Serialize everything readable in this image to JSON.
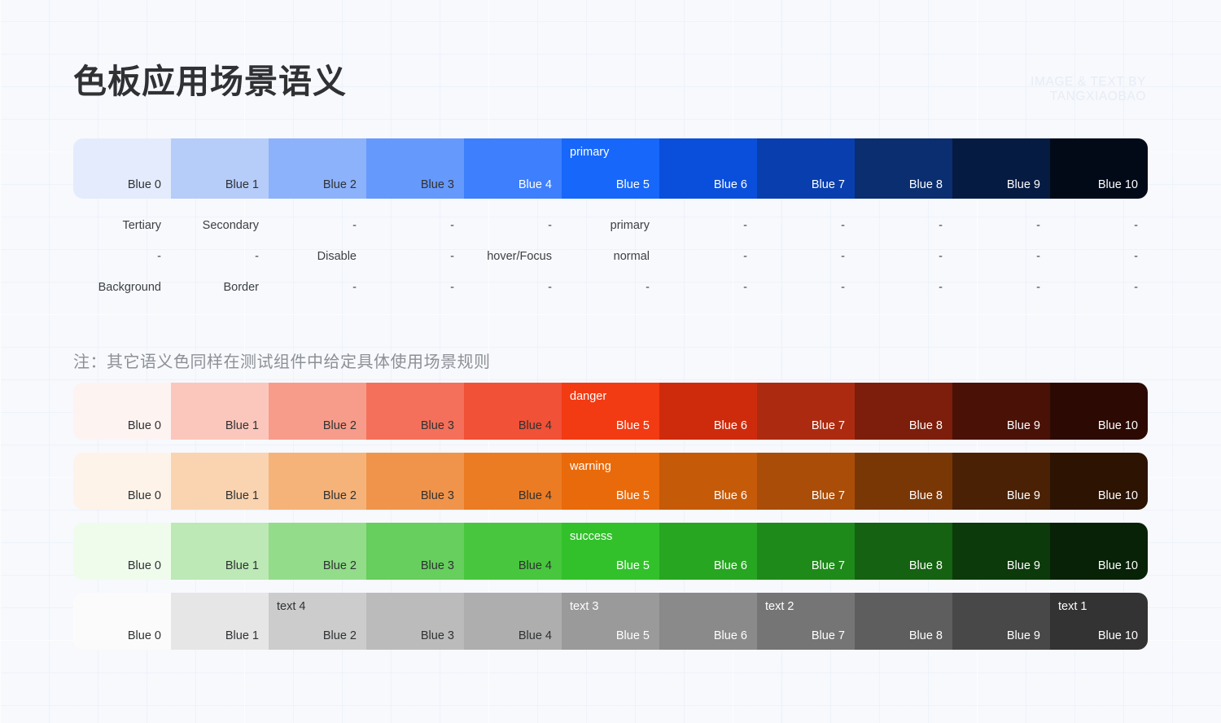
{
  "header": {
    "title": "色板应用场景语义",
    "watermark_line1": "IMAGE & TEXT BY",
    "watermark_line2": "TANGXIAOBAO"
  },
  "note": "注：其它语义色同样在测试组件中给定具体使用场景规则",
  "tone_labels": [
    "Blue 0",
    "Blue 1",
    "Blue 2",
    "Blue 3",
    "Blue 4",
    "Blue 5",
    "Blue 6",
    "Blue 7",
    "Blue 8",
    "Blue 9",
    "Blue 10"
  ],
  "palettes": [
    {
      "name": "blue",
      "accent": "#1667FA",
      "colors": [
        "#E4EBFC",
        "#B6CCF9",
        "#8CB2FB",
        "#6699FC",
        "#3D7FFC",
        "#1667FA",
        "#0A4FDB",
        "#093EAE",
        "#0B2E70",
        "#061B42",
        "#020A18"
      ],
      "text_colors": [
        "#2f3133",
        "#2f3133",
        "#2f3133",
        "#2f3133",
        "#ffffff",
        "#ffffff",
        "#ffffff",
        "#ffffff",
        "#ffffff",
        "#ffffff",
        "#ffffff"
      ],
      "roles": [
        "",
        "",
        "",
        "",
        "",
        "primary",
        "",
        "",
        "",
        "",
        ""
      ]
    },
    {
      "name": "red-danger",
      "accent": "#F23A13",
      "colors": [
        "#FDF3F1",
        "#FBC7BC",
        "#F79C8A",
        "#F4705A",
        "#F05137",
        "#F23A13",
        "#CE2B0D",
        "#AC2B10",
        "#7C1E0B",
        "#4A1206",
        "#2C0A03"
      ],
      "text_colors": [
        "#2f3133",
        "#2f3133",
        "#2f3133",
        "#2f3133",
        "#2f3133",
        "#ffffff",
        "#ffffff",
        "#ffffff",
        "#ffffff",
        "#ffffff",
        "#ffffff"
      ],
      "roles": [
        "",
        "",
        "",
        "",
        "",
        "danger",
        "",
        "",
        "",
        "",
        ""
      ]
    },
    {
      "name": "orange-warning",
      "accent": "#E96A0B",
      "colors": [
        "#FEF3E9",
        "#FAD4B0",
        "#F5B379",
        "#F0944B",
        "#EC7C23",
        "#E96A0B",
        "#C55A09",
        "#A94D08",
        "#7A3706",
        "#4A2104",
        "#2C1302"
      ],
      "text_colors": [
        "#2f3133",
        "#2f3133",
        "#2f3133",
        "#2f3133",
        "#2f3133",
        "#ffffff",
        "#ffffff",
        "#ffffff",
        "#ffffff",
        "#ffffff",
        "#ffffff"
      ],
      "roles": [
        "",
        "",
        "",
        "",
        "",
        "warning",
        "",
        "",
        "",
        "",
        ""
      ]
    },
    {
      "name": "green-success",
      "accent": "#32C12B",
      "colors": [
        "#EFFCEC",
        "#BCE9B5",
        "#93DC8A",
        "#66CF5D",
        "#48C73E",
        "#32C12B",
        "#27A621",
        "#1E8A1A",
        "#156212",
        "#0C3A0B",
        "#072206"
      ],
      "text_colors": [
        "#2f3133",
        "#2f3133",
        "#2f3133",
        "#2f3133",
        "#2f3133",
        "#ffffff",
        "#ffffff",
        "#ffffff",
        "#ffffff",
        "#ffffff",
        "#ffffff"
      ],
      "roles": [
        "",
        "",
        "",
        "",
        "",
        "success",
        "",
        "",
        "",
        "",
        ""
      ]
    },
    {
      "name": "gray-text",
      "accent": "#9A9A9A",
      "colors": [
        "#FBFBFB",
        "#E6E6E6",
        "#CCCCCC",
        "#BBBBBB",
        "#AEAEAE",
        "#9A9A9A",
        "#8A8A8A",
        "#757575",
        "#5E5E5E",
        "#484848",
        "#333333"
      ],
      "text_colors": [
        "#2f3133",
        "#2f3133",
        "#2f3133",
        "#2f3133",
        "#2f3133",
        "#ffffff",
        "#ffffff",
        "#ffffff",
        "#ffffff",
        "#ffffff",
        "#ffffff"
      ],
      "roles": [
        "",
        "",
        "text 4",
        "",
        "",
        "text 3",
        "",
        "text 2",
        "",
        "",
        "text 1"
      ]
    }
  ],
  "usage_rows": [
    [
      "Tertiary",
      "Secondary",
      "-",
      "-",
      "-",
      "primary",
      "-",
      "-",
      "-",
      "-",
      "-"
    ],
    [
      "-",
      "-",
      "Disable",
      "-",
      "hover/Focus",
      "normal",
      "-",
      "-",
      "-",
      "-",
      "-"
    ],
    [
      "Background",
      "Border",
      "-",
      "-",
      "-",
      "-",
      "-",
      "-",
      "-",
      "-",
      "-"
    ]
  ]
}
